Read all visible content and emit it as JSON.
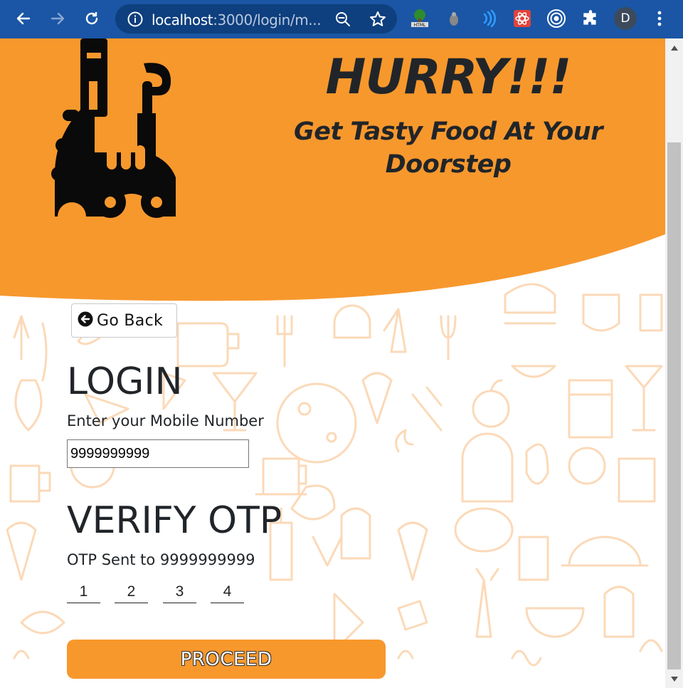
{
  "browser": {
    "url_host": "localhost",
    "url_rest": ":3000/login/m...",
    "profile_initial": "D",
    "theme_color": "#1a56a5"
  },
  "hero": {
    "headline": "HURRY!!!",
    "tagline": "Get Tasty Food At Your Doorstep",
    "background_color": "#f7982d"
  },
  "nav": {
    "go_back_label": "Go Back"
  },
  "login": {
    "heading": "LOGIN",
    "mobile_label": "Enter your Mobile Number",
    "mobile_value": "9999999999"
  },
  "otp": {
    "heading": "VERIFY OTP",
    "sent_text": "OTP Sent to 9999999999",
    "digits": [
      "1",
      "2",
      "3",
      "4"
    ]
  },
  "actions": {
    "proceed_label": "PROCEED",
    "proceed_color": "#f7982d"
  }
}
